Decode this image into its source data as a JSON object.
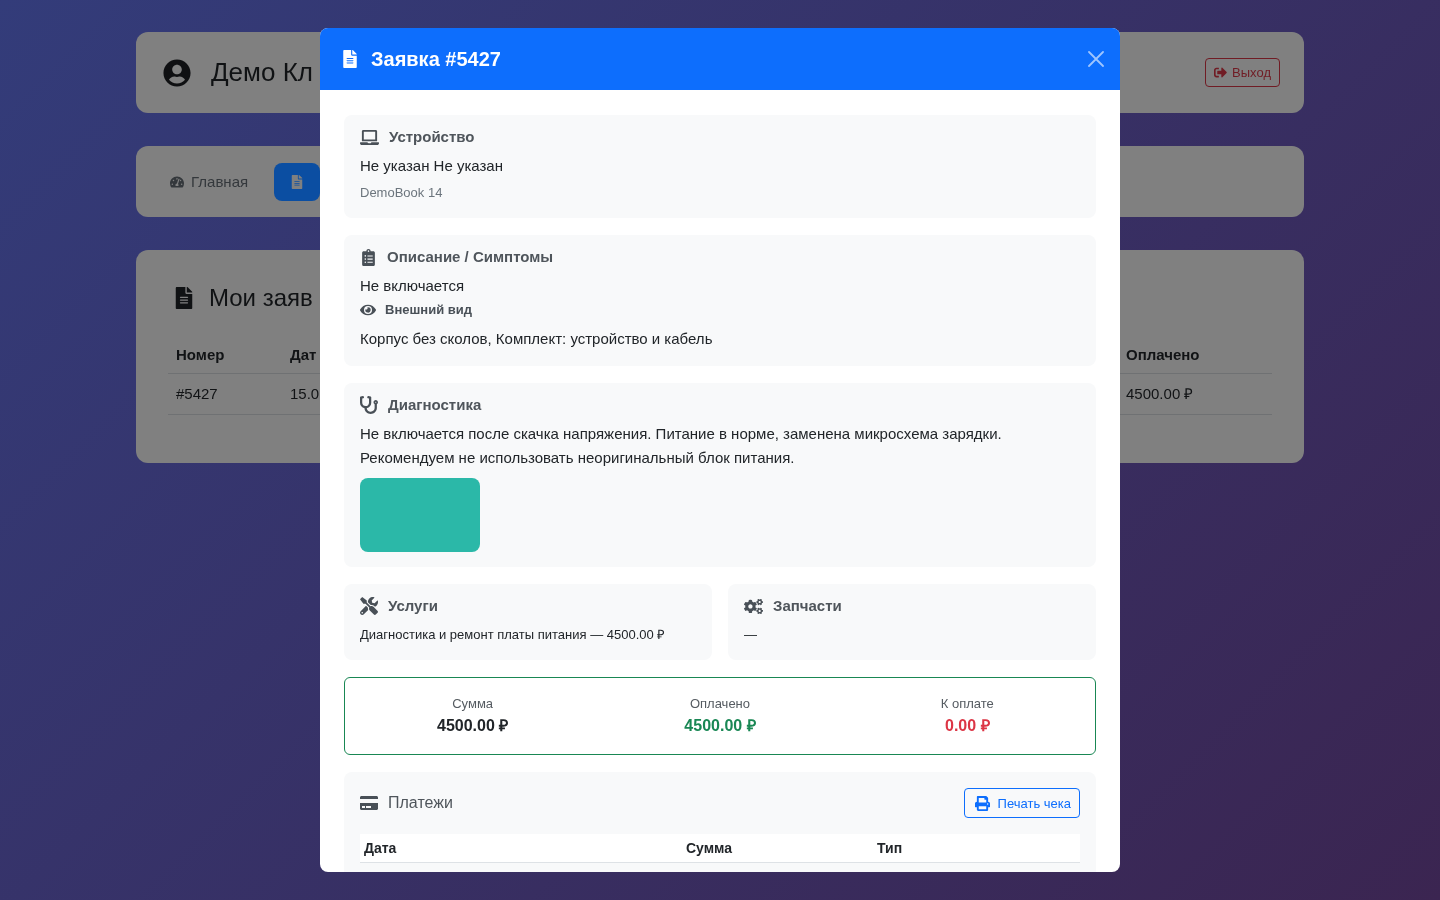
{
  "page": {
    "header": {
      "title": "Демо Кл",
      "logout_button": "Выход"
    },
    "nav": [
      {
        "kind": "dashboard",
        "label": "Главная",
        "selected": false
      },
      {
        "kind": "requests",
        "selected": true
      }
    ],
    "requests": {
      "title": "Мои заяв",
      "columns": [
        "Номер",
        "Дат",
        "Оплачено"
      ],
      "rows": [
        [
          "#5427",
          "15.0",
          "4500.00 ₽"
        ]
      ]
    }
  },
  "modal": {
    "title": "Заявка #5427",
    "device": {
      "title": "Устройство",
      "name": "Не указан Не указан",
      "model": "DemoBook 14"
    },
    "description": {
      "title": "Описание / Симптомы",
      "symptoms": "Не включается",
      "appearance_label": "Внешний вид",
      "appearance": "Корпус без сколов, Комплект: устройство и кабель"
    },
    "diagnostics": {
      "title": "Диагностика",
      "text": "Не включается после скачка напряжения. Питание в норме, заменена микросхема зарядки. Рекомендуем не использовать неоригинальный блок питания.",
      "attachments": [
        {
          "kind": "photo"
        }
      ]
    },
    "services": {
      "title": "Услуги",
      "items": [
        "Диагностика и ремонт платы питания — 4500.00 ₽"
      ]
    },
    "parts": {
      "title": "Запчасти",
      "items": [
        "—"
      ]
    },
    "totals": [
      {
        "label": "Сумма",
        "value": "4500.00 ₽",
        "color": "#212529"
      },
      {
        "label": "Оплачено",
        "value": "4500.00 ₽",
        "color": "#198754"
      },
      {
        "label": "К оплате",
        "value": "0.00 ₽",
        "color": "#dc3545"
      }
    ],
    "payments": {
      "title": "Платежи",
      "print_button": "Печать чека",
      "columns": [
        "Дата",
        "Сумма",
        "Тип"
      ]
    }
  }
}
